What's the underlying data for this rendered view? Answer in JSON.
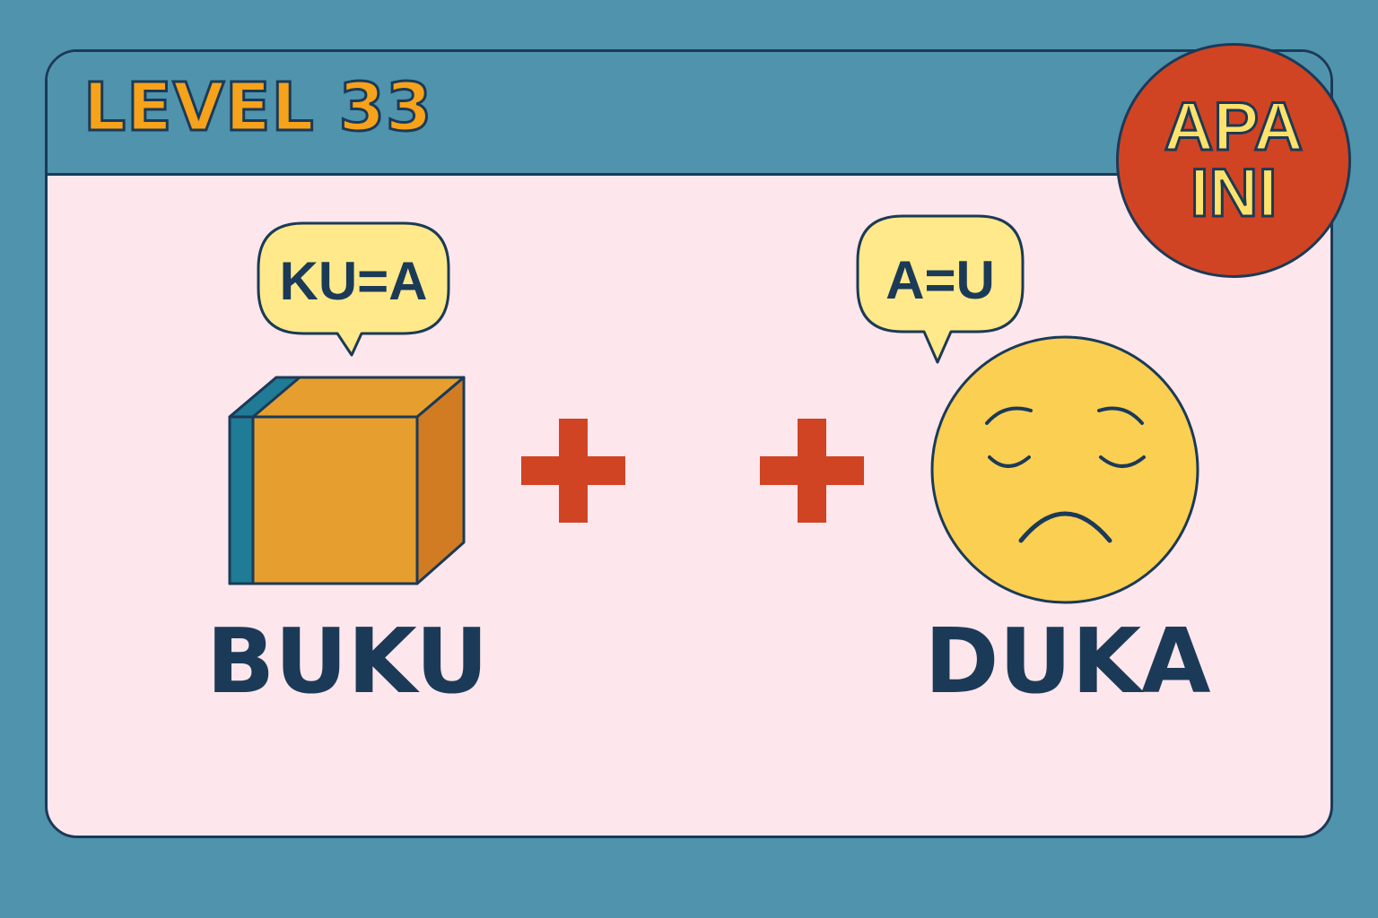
{
  "level": {
    "title": "LEVEL 33"
  },
  "badge": {
    "line1": "APA",
    "line2": "INI"
  },
  "clues": [
    {
      "word": "BUKU",
      "bubble_text": "KU=A",
      "icon": "box-icon"
    },
    {
      "word": "DUKA",
      "bubble_text": "A=U",
      "icon": "sad-face-icon"
    }
  ],
  "operators": [
    "+",
    "+"
  ],
  "colors": {
    "background": "#4f93ad",
    "card": "#fde6ec",
    "outline": "#1b3a57",
    "title": "#f7a21b",
    "badge": "#d04423",
    "badge_text": "#ffe26b",
    "bubble": "#ffe98a",
    "plus": "#d04423",
    "box": "#e69f2f",
    "face": "#fbcf52"
  }
}
